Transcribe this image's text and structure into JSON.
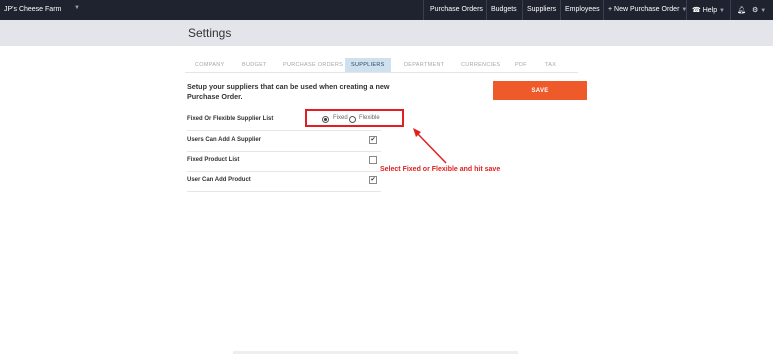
{
  "nav": {
    "brand": "JP's Cheese Farm",
    "items": [
      "Purchase Orders",
      "Budgets",
      "Suppliers",
      "Employees"
    ],
    "new_po": "New Purchase Order",
    "help": "Help"
  },
  "page": {
    "title": "Settings"
  },
  "tabs": [
    {
      "label": "COMPANY",
      "active": false
    },
    {
      "label": "BUDGET",
      "active": false
    },
    {
      "label": "PURCHASE ORDERS",
      "active": false
    },
    {
      "label": "SUPPLIERS",
      "active": true
    },
    {
      "label": "DEPARTMENT",
      "active": false
    },
    {
      "label": "CURRENCIES",
      "active": false
    },
    {
      "label": "PDF",
      "active": false
    },
    {
      "label": "TAX",
      "active": false
    }
  ],
  "intro": "Setup your suppliers that can be used when creating a new Purchase Order.",
  "save_label": "SAVE",
  "settings": {
    "supplier_list": {
      "label": "Fixed Or Flexible Supplier List",
      "options": [
        "Fixed",
        "Flexible"
      ],
      "selected": "Fixed"
    },
    "rows": [
      {
        "label": "Users Can Add A Supplier",
        "checked": true
      },
      {
        "label": "Fixed Product List",
        "checked": false
      },
      {
        "label": "User Can Add Product",
        "checked": true
      }
    ]
  },
  "annotation": "Select Fixed or Flexible and hit save",
  "colors": {
    "accent": "#ef5a2b",
    "annotation": "#e02020",
    "nav_bg": "#1f2330",
    "active_tab": "#cfe0ee"
  }
}
